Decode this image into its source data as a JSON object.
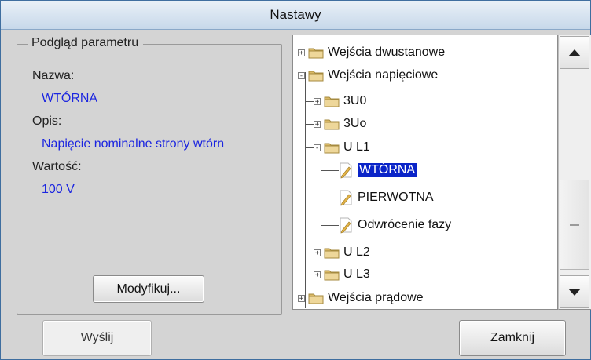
{
  "window": {
    "title": "Nastawy"
  },
  "preview": {
    "legend": "Podgląd parametru",
    "name_label": "Nazwa:",
    "name_value": "WTÓRNA",
    "desc_label": "Opis:",
    "desc_value": "Napięcie nominalne strony wtórn",
    "value_label": "Wartość:",
    "value_value": "100 V",
    "modify_button": "Modyfikuj..."
  },
  "tree": {
    "nodes": [
      {
        "label": "Wejścia dwustanowe",
        "type": "folder",
        "expander": "+"
      },
      {
        "label": "Wejścia napięciowe",
        "type": "folder",
        "expander": "-"
      },
      {
        "label": "3U0",
        "type": "folder",
        "expander": "+"
      },
      {
        "label": "3Uo",
        "type": "folder",
        "expander": "+"
      },
      {
        "label": "U L1",
        "type": "folder",
        "expander": "-"
      },
      {
        "label": "WTÓRNA",
        "type": "param",
        "selected": true
      },
      {
        "label": "PIERWOTNA",
        "type": "param"
      },
      {
        "label": "Odwrócenie fazy",
        "type": "param"
      },
      {
        "label": "U L2",
        "type": "folder",
        "expander": "+"
      },
      {
        "label": "U L3",
        "type": "folder",
        "expander": "+"
      },
      {
        "label": "Wejścia prądowe",
        "type": "folder",
        "expander": "+"
      }
    ]
  },
  "footer": {
    "send_button": "Wyślij",
    "close_button": "Zamknij"
  },
  "colors": {
    "value_text": "#1b25e0",
    "selection": "#0a24c8"
  }
}
